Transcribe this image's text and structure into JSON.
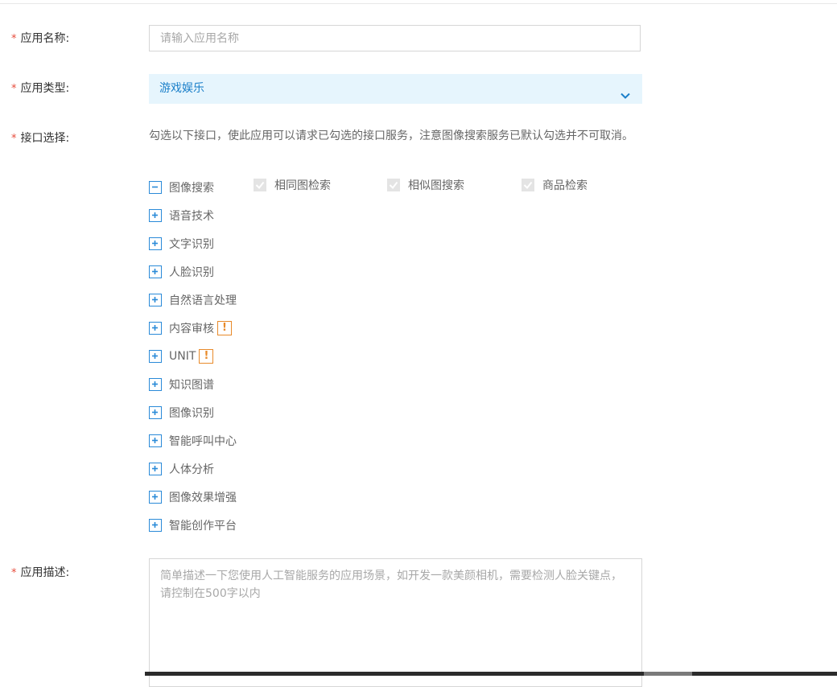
{
  "form": {
    "required_mark": "*",
    "app_name": {
      "label": "应用名称:",
      "placeholder": "请输入应用名称",
      "value": ""
    },
    "app_type": {
      "label": "应用类型:",
      "selected": "游戏娱乐"
    },
    "api_select": {
      "label": "接口选择:",
      "description": "勾选以下接口，使此应用可以请求已勾选的接口服务，注意图像搜索服务已默认勾选并不可取消。",
      "groups": [
        {
          "name": "图像搜索",
          "expanded": true,
          "warning": false,
          "children": [
            {
              "label": "相同图检索",
              "checked": true,
              "disabled": true
            },
            {
              "label": "相似图搜索",
              "checked": true,
              "disabled": true
            },
            {
              "label": "商品检索",
              "checked": true,
              "disabled": true
            }
          ]
        },
        {
          "name": "语音技术",
          "expanded": false,
          "warning": false
        },
        {
          "name": "文字识别",
          "expanded": false,
          "warning": false
        },
        {
          "name": "人脸识别",
          "expanded": false,
          "warning": false
        },
        {
          "name": "自然语言处理",
          "expanded": false,
          "warning": false
        },
        {
          "name": "内容审核",
          "expanded": false,
          "warning": true
        },
        {
          "name": "UNIT",
          "expanded": false,
          "warning": true
        },
        {
          "name": "知识图谱",
          "expanded": false,
          "warning": false
        },
        {
          "name": "图像识别",
          "expanded": false,
          "warning": false
        },
        {
          "name": "智能呼叫中心",
          "expanded": false,
          "warning": false
        },
        {
          "name": "人体分析",
          "expanded": false,
          "warning": false
        },
        {
          "name": "图像效果增强",
          "expanded": false,
          "warning": false
        },
        {
          "name": "智能创作平台",
          "expanded": false,
          "warning": false
        }
      ],
      "warning_symbol": "!"
    },
    "app_desc": {
      "label": "应用描述:",
      "placeholder": "简单描述一下您使用人工智能服务的应用场景，如开发一款美颜相机，需要检测人脸关键点，请控制在500字以内",
      "value": ""
    }
  },
  "colors": {
    "accent": "#2a8ad8",
    "required": "#e74c3c",
    "warning": "#e88a2a",
    "select_bg": "#e6f5fd"
  }
}
